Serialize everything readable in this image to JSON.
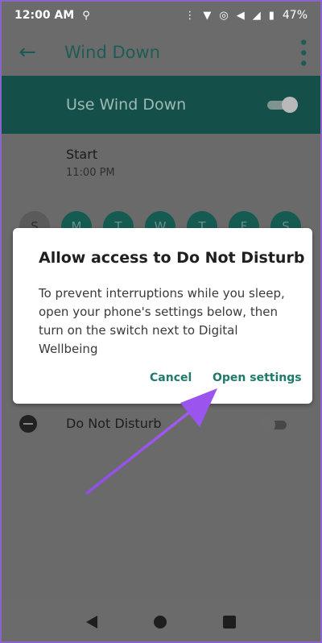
{
  "status_bar": {
    "time": "12:00 AM",
    "battery": "47%",
    "icons": [
      "signal-icon",
      "wifi-icon",
      "hotspot-icon",
      "volume-icon",
      "data-icon",
      "battery-icon"
    ]
  },
  "app_bar": {
    "title": "Wind Down"
  },
  "wind_down": {
    "use_label": "Use Wind Down",
    "use_enabled": true,
    "start_label": "Start",
    "start_time": "11:00 PM",
    "days": [
      {
        "letter": "S",
        "selected": false
      },
      {
        "letter": "M",
        "selected": true
      },
      {
        "letter": "T",
        "selected": true
      },
      {
        "letter": "W",
        "selected": true
      },
      {
        "letter": "T",
        "selected": true
      },
      {
        "letter": "F",
        "selected": true
      },
      {
        "letter": "S",
        "selected": true
      }
    ],
    "dnd_label": "Do Not Disturb",
    "dnd_enabled": false
  },
  "dialog": {
    "title": "Allow access to Do Not Disturb",
    "message": "To prevent interruptions while you sleep, open your phone's settings below, then turn on the switch next to Digital Wellbeing",
    "cancel_label": "Cancel",
    "open_label": "Open settings"
  },
  "colors": {
    "accent": "#1e7a6a",
    "arrow": "#8a4be0",
    "frame": "#8a64c6"
  }
}
